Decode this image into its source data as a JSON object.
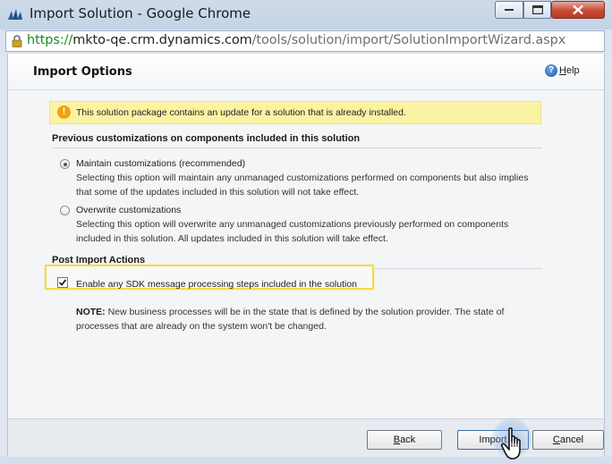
{
  "window": {
    "title": "Import Solution - Google Chrome",
    "controls": [
      "minimize-icon",
      "maximize-icon",
      "close-icon"
    ]
  },
  "address": {
    "scheme": "https://",
    "host": "mkto-qe.crm.dynamics.com",
    "path": "/tools/solution/import/SolutionImportWizard.aspx"
  },
  "header": {
    "title": "Import Options",
    "help_first": "H",
    "help_rest": "elp"
  },
  "warning": {
    "icon": "!",
    "text": "This solution package contains an update for a solution that is already installed."
  },
  "customizations": {
    "section_title": "Previous customizations on components included in this solution",
    "options": [
      {
        "label": "Maintain customizations (recommended)",
        "description": "Selecting this option will maintain any unmanaged customizations performed on components but also implies that some of the updates included in this solution will not take effect.",
        "selected": true
      },
      {
        "label": "Overwrite customizations",
        "description": "Selecting this option will overwrite any unmanaged customizations previously performed on components included in this solution. All updates included in this solution will take effect.",
        "selected": false
      }
    ]
  },
  "post_import": {
    "section_title": "Post Import Actions",
    "checkbox_label": "Enable any SDK message processing steps included in the solution",
    "checked": true,
    "note_label": "NOTE:",
    "note_text": " New business processes will be in the state that is defined by the solution provider. The state of processes that are already on the system won't be changed."
  },
  "footer": {
    "back_first": "B",
    "back_rest": "ack",
    "import_label": "Import",
    "cancel_first": "C",
    "cancel_rest": "ancel"
  },
  "colors": {
    "warning_bg": "#fbf3a4",
    "highlight_border": "#f1dc4c",
    "url_scheme": "#1a8a1a"
  }
}
